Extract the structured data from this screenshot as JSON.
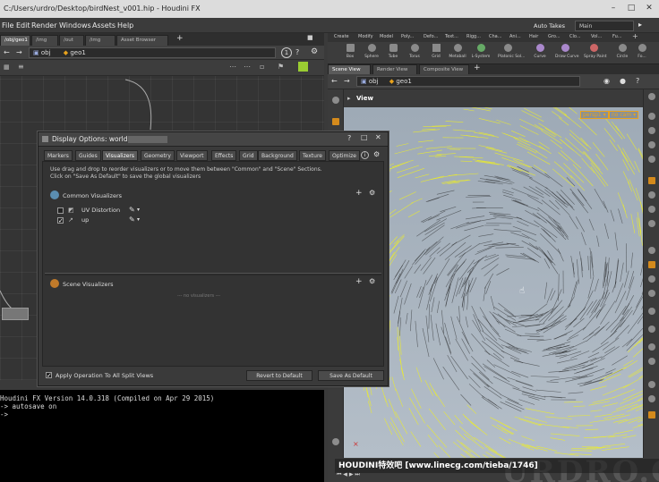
{
  "window": {
    "title": "C:/Users/urdro/Desktop/birdNest_v001.hip - Houdini FX",
    "min": "–",
    "max": "□",
    "close": "✕"
  },
  "menu": {
    "items": [
      "File",
      "Edit",
      "Render",
      "Windows",
      "Assets",
      "Help"
    ],
    "auto_takes": "Auto Takes",
    "desktop": "Main"
  },
  "left_pane": {
    "tabs": [
      "/obj/geo1",
      "/img",
      "/out",
      "/img",
      "Asset Browser"
    ],
    "path_obj": "obj",
    "path_geo": "geo1"
  },
  "shelf": {
    "tabs": [
      "Create",
      "Modify",
      "Model",
      "Poly...",
      "Defo...",
      "Text...",
      "Rigg...",
      "Cha...",
      "Ani...",
      "Hair",
      "Gro...",
      "Clo...",
      "Vol...",
      "Fu..."
    ],
    "tools": [
      "Box",
      "Sphere",
      "Tube",
      "Torus",
      "Grid",
      "Metaball",
      "L-System",
      "Platonic Sol...",
      "Curve",
      "Draw Curve",
      "Spray Paint",
      "Circle",
      "Fo..."
    ]
  },
  "right_pane": {
    "tabs": [
      "Scene View",
      "Render View",
      "Composite View"
    ],
    "path_obj": "obj",
    "path_geo": "geo1",
    "view_label": "View",
    "persp": "persp1 ▾",
    "cam": "no cam ▾"
  },
  "dialog": {
    "title": "Display Options: world",
    "help": "?",
    "tabs": [
      "Markers",
      "Guides",
      "Visualizers",
      "Geometry",
      "Viewport",
      "Effects",
      "Grid",
      "Background",
      "Texture",
      "Optimize"
    ],
    "active_tab": "Visualizers",
    "info_line1": "Use drag and drop to reorder visualizers or to move them between \"Common\" and \"Scene\" Sections.",
    "info_line2": "Click on \"Save As Default\" to save the global visualizers",
    "common_heading": "Common Visualizers",
    "common_items": [
      {
        "label": "UV Distortion",
        "checked": false
      },
      {
        "label": "up",
        "checked": true
      }
    ],
    "scene_heading": "Scene Visualizers",
    "scene_empty": "--- no visualizers ---",
    "apply_label": "Apply Operation To All Split Views",
    "apply_checked": true,
    "revert_label": "Revert to Default",
    "save_label": "Save As Default"
  },
  "console": {
    "lines": [
      "Houdini FX Version 14.0.318 (Compiled on Apr 29 2015)",
      "-> autosave on",
      "->"
    ]
  },
  "watermark": {
    "text": "HOUDINI特效吧  [www.linecg.com/tieba/1746]",
    "brand": "URDRO.COM"
  },
  "colors": {
    "accent": "#e8a21c",
    "curves": "#f0f020",
    "viewport_bg": "#a8b3be"
  }
}
